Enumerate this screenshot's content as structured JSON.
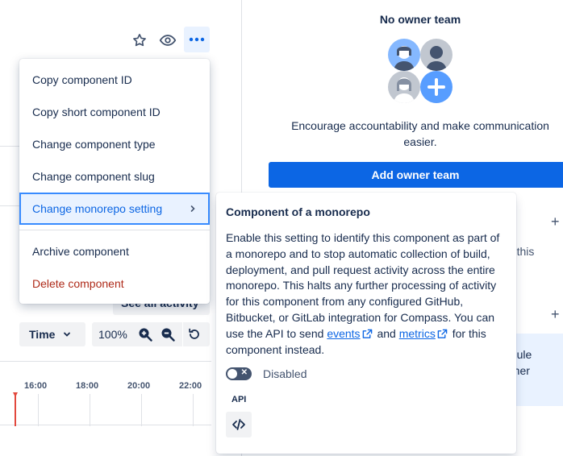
{
  "toolbar": {
    "star_icon": "star-icon",
    "watch_icon": "eye-icon",
    "more_icon": "more-icon"
  },
  "menu": {
    "items": [
      {
        "label": "Copy component ID"
      },
      {
        "label": "Copy short component ID"
      },
      {
        "label": "Change component type"
      },
      {
        "label": "Change component slug"
      },
      {
        "label": "Change monorepo setting"
      },
      {
        "label": "Archive component"
      },
      {
        "label": "Delete component"
      }
    ]
  },
  "activity": {
    "see_all_label": "See all activity",
    "time_label": "Time",
    "zoom_level": "100%",
    "timeline_labels": [
      "16:00",
      "18:00",
      "20:00",
      "22:00"
    ]
  },
  "owner": {
    "title": "No owner team",
    "description": "Encourage accountability and make communication easier.",
    "add_label": "Add owner team",
    "peek_text1": "ut this",
    "peek_text2a": "edule",
    "peek_text2b": "other"
  },
  "popup": {
    "title": "Component of a monorepo",
    "body_prefix": "Enable this setting to identify this component as part of a monorepo and to stop automatic collection of build, deployment, and pull request activity across the entire monorepo. This halts any further processing of activity for this component from any configured GitHub, Bitbucket, or GitLab integration for Compass. You can use the API to send ",
    "events_link": "events",
    "and_text": "and ",
    "metrics_link": "metrics",
    "body_suffix": " for this component instead.",
    "toggle_label": "Disabled",
    "toggle_state": false,
    "api_label": "API"
  },
  "colors": {
    "primary": "#0c66e4",
    "danger": "#ae2a19",
    "selected_bg": "#e9f2ff",
    "now_marker": "#e2483d"
  }
}
